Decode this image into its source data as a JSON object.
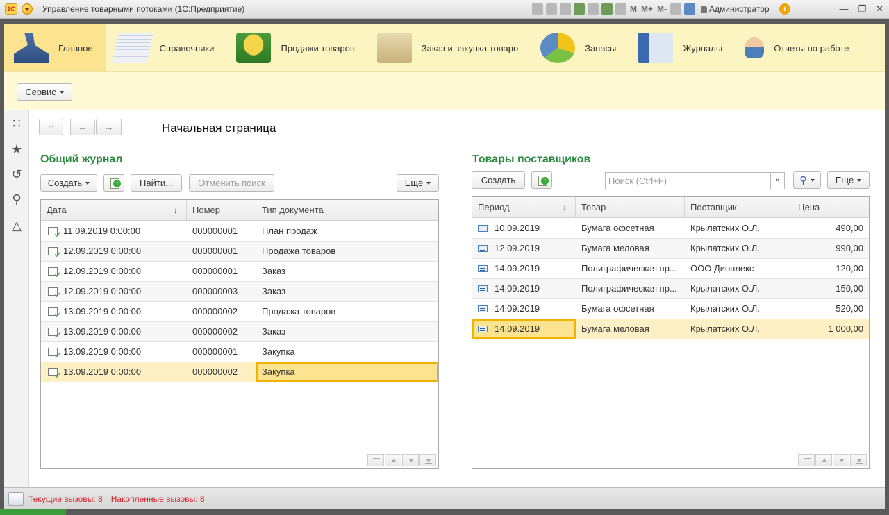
{
  "window": {
    "title": "Управление товарными потоками  (1С:Предприятие)",
    "logo": "1С",
    "user": "Администратор",
    "m_buttons": [
      "M",
      "M+",
      "M-"
    ]
  },
  "sections": [
    {
      "label": "Главное",
      "icon": "desk-lamp-icon",
      "active": true
    },
    {
      "label": "Справочники",
      "icon": "papers-stack-icon"
    },
    {
      "label": "Продажи товаров",
      "icon": "coins-icon"
    },
    {
      "label": "Заказ и закупка товаро",
      "icon": "folder-icon"
    },
    {
      "label": "Запасы",
      "icon": "pie-chart-icon"
    },
    {
      "label": "Журналы",
      "icon": "books-icon"
    },
    {
      "label": "Отчеты по работе",
      "icon": "person-icon"
    }
  ],
  "command_bar": {
    "service_label": "Сервис"
  },
  "nav": {
    "page_title": "Начальная страница"
  },
  "journal": {
    "title": "Общий журнал",
    "create_label": "Создать",
    "find_label": "Найти...",
    "cancel_search_label": "Отменить поиск",
    "more_label": "Еще",
    "columns": [
      "Дата",
      "Номер",
      "Тип документа"
    ],
    "rows": [
      {
        "date": "11.09.2019 0:00:00",
        "number": "000000001",
        "type": "План продаж"
      },
      {
        "date": "12.09.2019 0:00:00",
        "number": "000000001",
        "type": "Продажа товаров"
      },
      {
        "date": "12.09.2019 0:00:00",
        "number": "000000001",
        "type": "Заказ"
      },
      {
        "date": "12.09.2019 0:00:00",
        "number": "000000003",
        "type": "Заказ"
      },
      {
        "date": "13.09.2019 0:00:00",
        "number": "000000002",
        "type": "Продажа товаров"
      },
      {
        "date": "13.09.2019 0:00:00",
        "number": "000000002",
        "type": "Заказ"
      },
      {
        "date": "13.09.2019 0:00:00",
        "number": "000000001",
        "type": "Закупка"
      },
      {
        "date": "13.09.2019 0:00:00",
        "number": "000000002",
        "type": "Закупка"
      }
    ]
  },
  "suppliers": {
    "title": "Товары поставщиков",
    "create_label": "Создать",
    "search_placeholder": "Поиск (Ctrl+F)",
    "clear_glyph": "×",
    "more_label": "Еще",
    "columns": [
      "Период",
      "Товар",
      "Поставщик",
      "Цена"
    ],
    "rows": [
      {
        "period": "10.09.2019",
        "product": "Бумага офсетная",
        "supplier": "Крылатских О.Л.",
        "price": "490,00"
      },
      {
        "period": "12.09.2019",
        "product": "Бумага меловая",
        "supplier": "Крылатских О.Л.",
        "price": "990,00"
      },
      {
        "period": "14.09.2019",
        "product": "Полиграфическая пр...",
        "supplier": "ООО Диоплекс",
        "price": "120,00"
      },
      {
        "period": "14.09.2019",
        "product": "Полиграфическая пр...",
        "supplier": "Крылатских О.Л.",
        "price": "150,00"
      },
      {
        "period": "14.09.2019",
        "product": "Бумага офсетная",
        "supplier": "Крылатских О.Л.",
        "price": "520,00"
      },
      {
        "period": "14.09.2019",
        "product": "Бумага меловая",
        "supplier": "Крылатских О.Л.",
        "price": "1 000,00"
      }
    ]
  },
  "status": {
    "current_calls": "Текущие вызовы: 8",
    "accumulated_calls": "Накопленные вызовы: 8"
  },
  "colors": {
    "section_panel": "#fcf5c2",
    "active_section": "#fbe38f",
    "group_title": "#2a8a3e",
    "selected_row": "#fdf0c4",
    "status_text": "#d9232e"
  }
}
